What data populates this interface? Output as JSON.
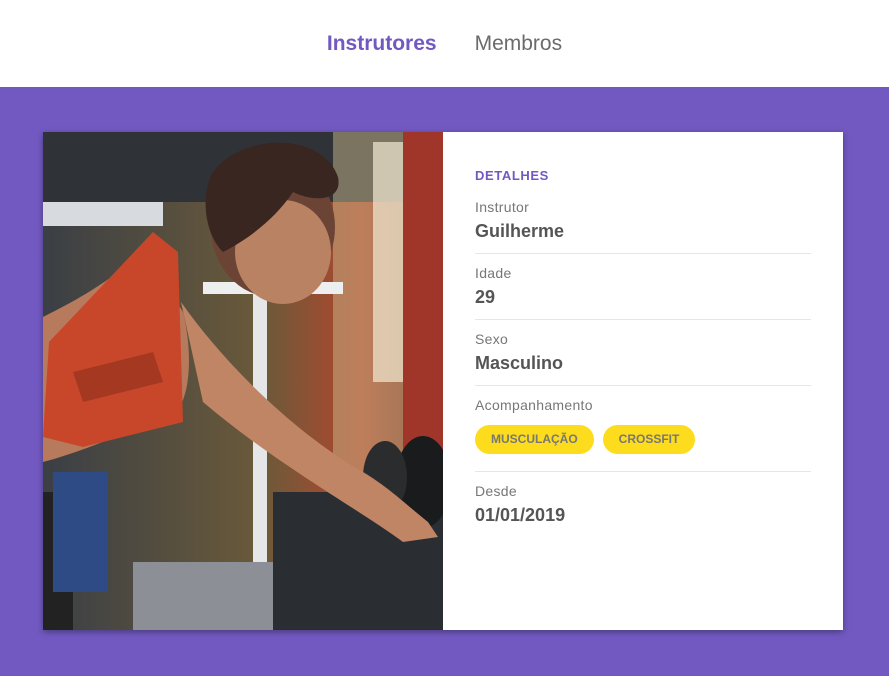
{
  "nav": {
    "items": [
      {
        "label": "Instrutores",
        "active": true
      },
      {
        "label": "Membros",
        "active": false
      }
    ]
  },
  "details": {
    "section_title": "DETALHES",
    "instructor_label": "Instrutor",
    "instructor_value": "Guilherme",
    "age_label": "Idade",
    "age_value": "29",
    "gender_label": "Sexo",
    "gender_value": "Masculino",
    "services_label": "Acompanhamento",
    "services": [
      "MUSCULAÇÃO",
      "CROSSFIT"
    ],
    "since_label": "Desde",
    "since_value": "01/01/2019"
  },
  "colors": {
    "accent": "#7159c1",
    "tag": "#fcdc1c"
  },
  "photo": {
    "icon": "gym-photo"
  }
}
